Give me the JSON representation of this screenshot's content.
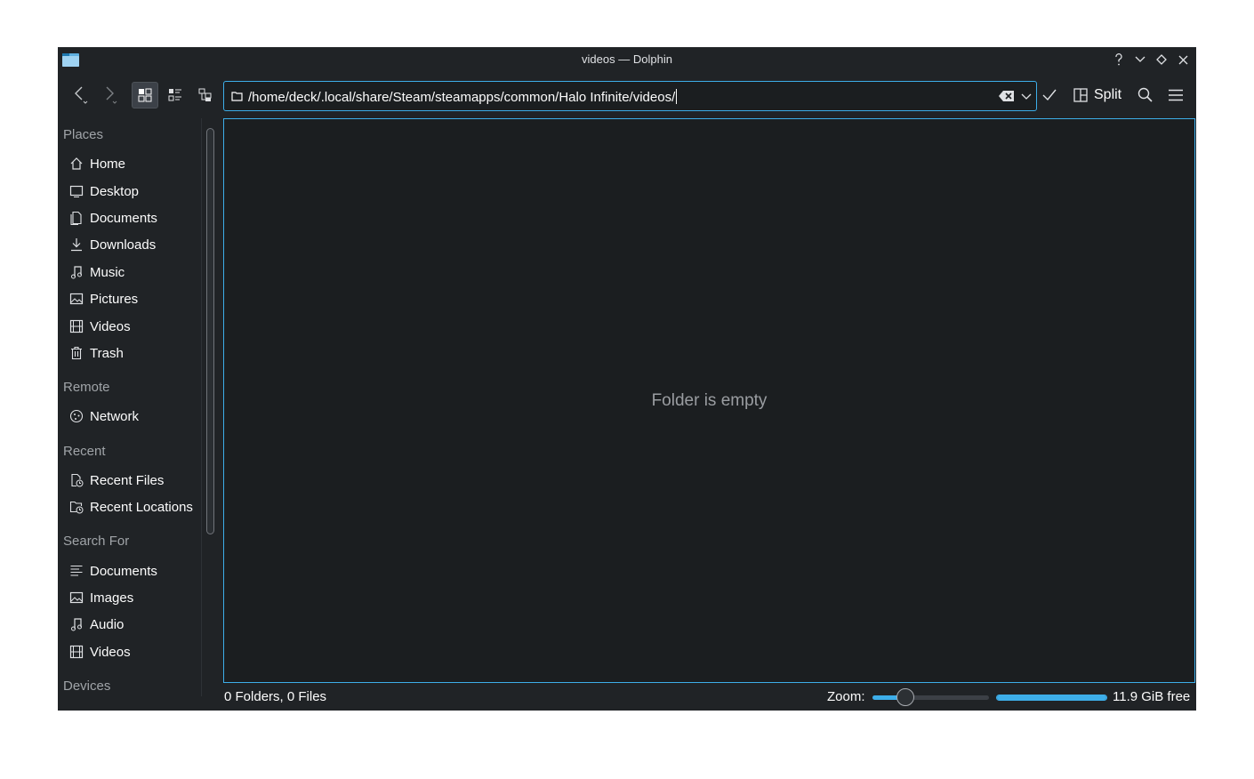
{
  "window": {
    "title": "videos — Dolphin",
    "buttons": [
      "help-icon",
      "minimize-icon",
      "maximize-icon",
      "close-icon"
    ]
  },
  "toolbar": {
    "back_icon": "back-icon",
    "forward_icon": "forward-icon",
    "view_modes": [
      "icons-view-icon",
      "compact-view-icon",
      "details-view-icon"
    ],
    "active_view": "icons",
    "location_path": "/home/deck/.local/share/Steam/steamapps/common/Halo Infinite/videos/",
    "split_label": "Split"
  },
  "sidebar": {
    "places_header": "Places",
    "places": [
      {
        "label": "Home",
        "icon": "home-icon"
      },
      {
        "label": "Desktop",
        "icon": "desktop-icon"
      },
      {
        "label": "Documents",
        "icon": "documents-icon"
      },
      {
        "label": "Downloads",
        "icon": "downloads-icon"
      },
      {
        "label": "Music",
        "icon": "music-icon"
      },
      {
        "label": "Pictures",
        "icon": "pictures-icon"
      },
      {
        "label": "Videos",
        "icon": "videos-icon"
      },
      {
        "label": "Trash",
        "icon": "trash-icon"
      }
    ],
    "remote_header": "Remote",
    "remote": [
      {
        "label": "Network",
        "icon": "network-icon"
      }
    ],
    "recent_header": "Recent",
    "recent": [
      {
        "label": "Recent Files",
        "icon": "recent-files-icon"
      },
      {
        "label": "Recent Locations",
        "icon": "recent-locations-icon"
      }
    ],
    "search_header": "Search For",
    "search": [
      {
        "label": "Documents",
        "icon": "text-documents-icon"
      },
      {
        "label": "Images",
        "icon": "images-icon"
      },
      {
        "label": "Audio",
        "icon": "audio-icon"
      },
      {
        "label": "Videos",
        "icon": "videos-icon"
      }
    ],
    "devices_header": "Devices"
  },
  "content": {
    "empty_message": "Folder is empty"
  },
  "statusbar": {
    "summary": "0 Folders, 0 Files",
    "zoom_label": "Zoom:",
    "zoom_fraction": 0.28,
    "space_used_fraction": 1.0,
    "free_space": "11.9 GiB free"
  },
  "colors": {
    "accent": "#3daee9",
    "window_bg": "#202326",
    "view_bg": "#1b1e20",
    "text": "#fcfcfc"
  }
}
